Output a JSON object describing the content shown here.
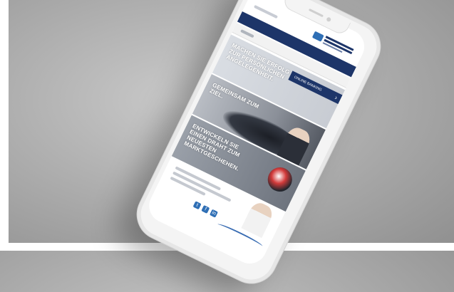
{
  "banners": [
    {
      "headline": "MACHEN SIE ERFOLG ZUR PERSÖNLICHEN ANGELEGENHEIT."
    },
    {
      "headline": "GEMEINSAM ZUM ZIEL."
    },
    {
      "headline": "ENTWICKELN SIE EINEN DRAHT ZUM NEUESTEN MARKTGESCHEHEN."
    }
  ],
  "online_banking": {
    "label": "ONLINE BANKING",
    "arrow": "›"
  },
  "socials": [
    {
      "name": "twitter-icon",
      "glyph": "t"
    },
    {
      "name": "facebook-icon",
      "glyph": "f"
    },
    {
      "name": "linkedin-icon",
      "glyph": "in"
    }
  ],
  "colors": {
    "brand_navy": "#1d3569",
    "brand_blue": "#2f6fb5"
  }
}
